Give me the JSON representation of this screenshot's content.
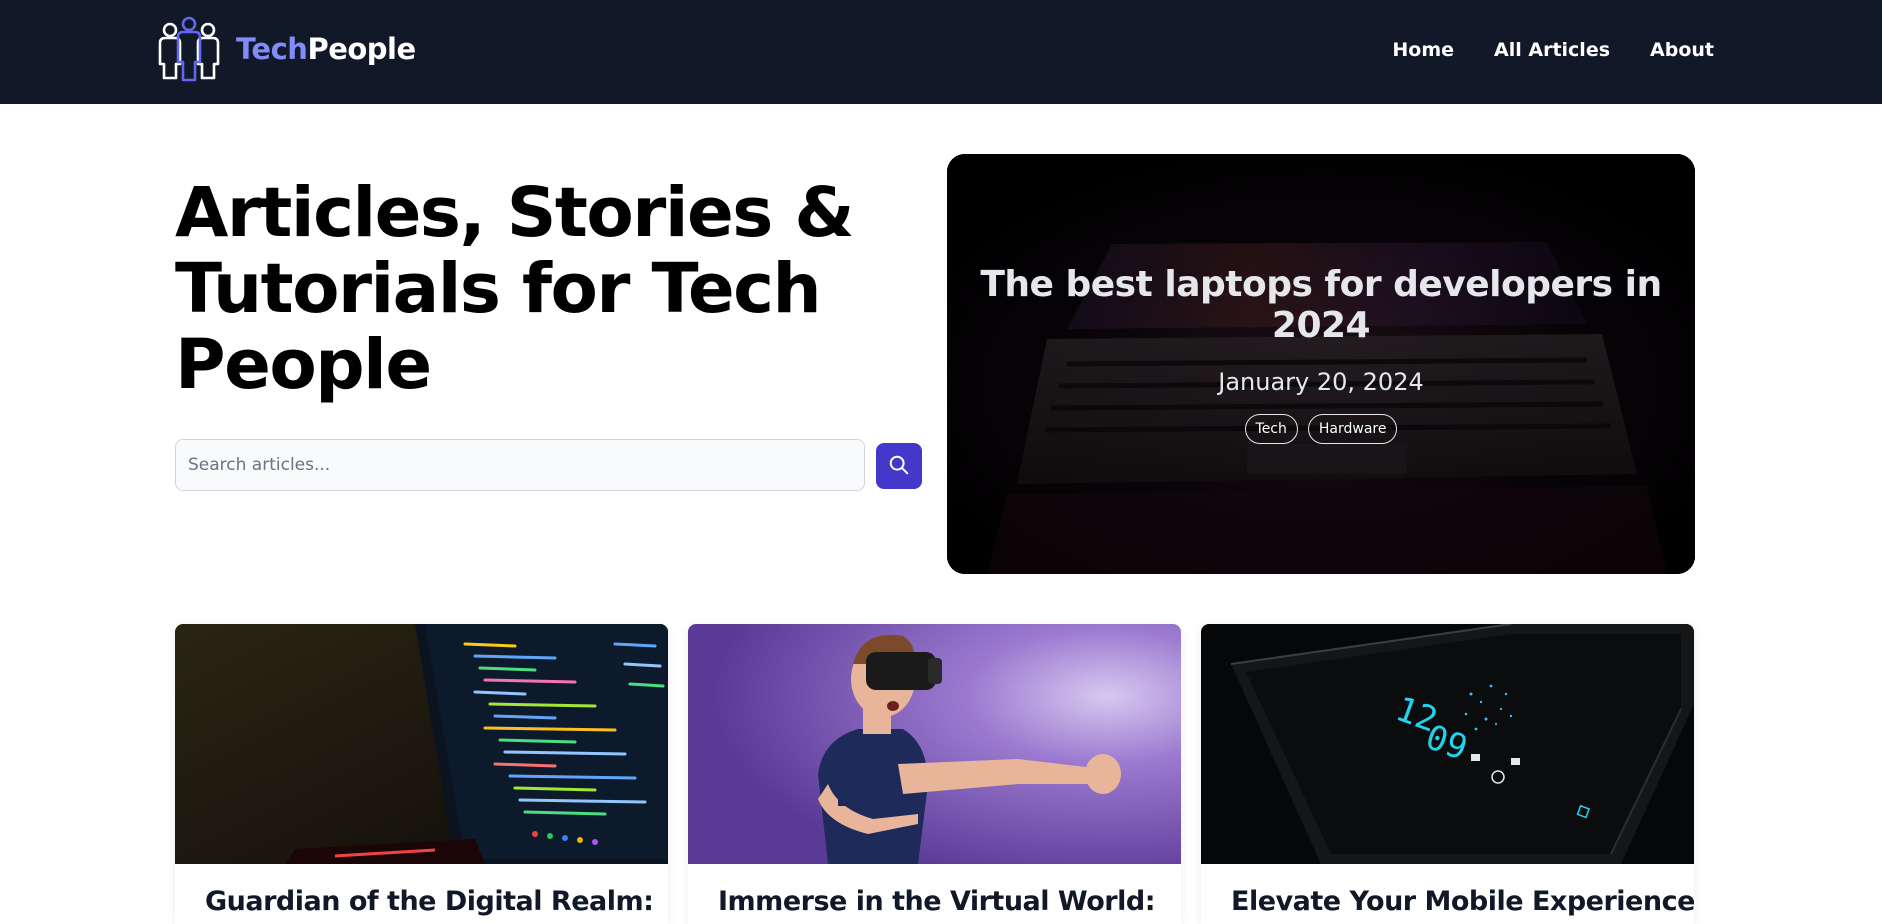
{
  "brand": {
    "name_part1": "Tech",
    "name_part2": "People",
    "logo_icon": "people-group-icon",
    "accent_color": "#818cf8"
  },
  "nav": {
    "items": [
      {
        "label": "Home"
      },
      {
        "label": "All Articles"
      },
      {
        "label": "About"
      }
    ],
    "background": "#111827"
  },
  "hero": {
    "title": "Articles, Stories & Tutorials for Tech People",
    "search": {
      "placeholder": "Search articles...",
      "value": "",
      "button_icon": "search-icon",
      "button_color": "#4338ca"
    }
  },
  "featured": {
    "title": "The best laptops for developers in 2024",
    "date": "January 20, 2024",
    "tags": [
      "Tech",
      "Hardware"
    ],
    "image_icon": "laptop-image"
  },
  "cards": [
    {
      "title": "Guardian of the Digital Realm:",
      "image_icon": "code-monitor-image"
    },
    {
      "title": "Immerse in the Virtual World:",
      "image_icon": "vr-headset-image"
    },
    {
      "title": "Elevate Your Mobile Experience",
      "image_icon": "smartphone-image"
    }
  ]
}
